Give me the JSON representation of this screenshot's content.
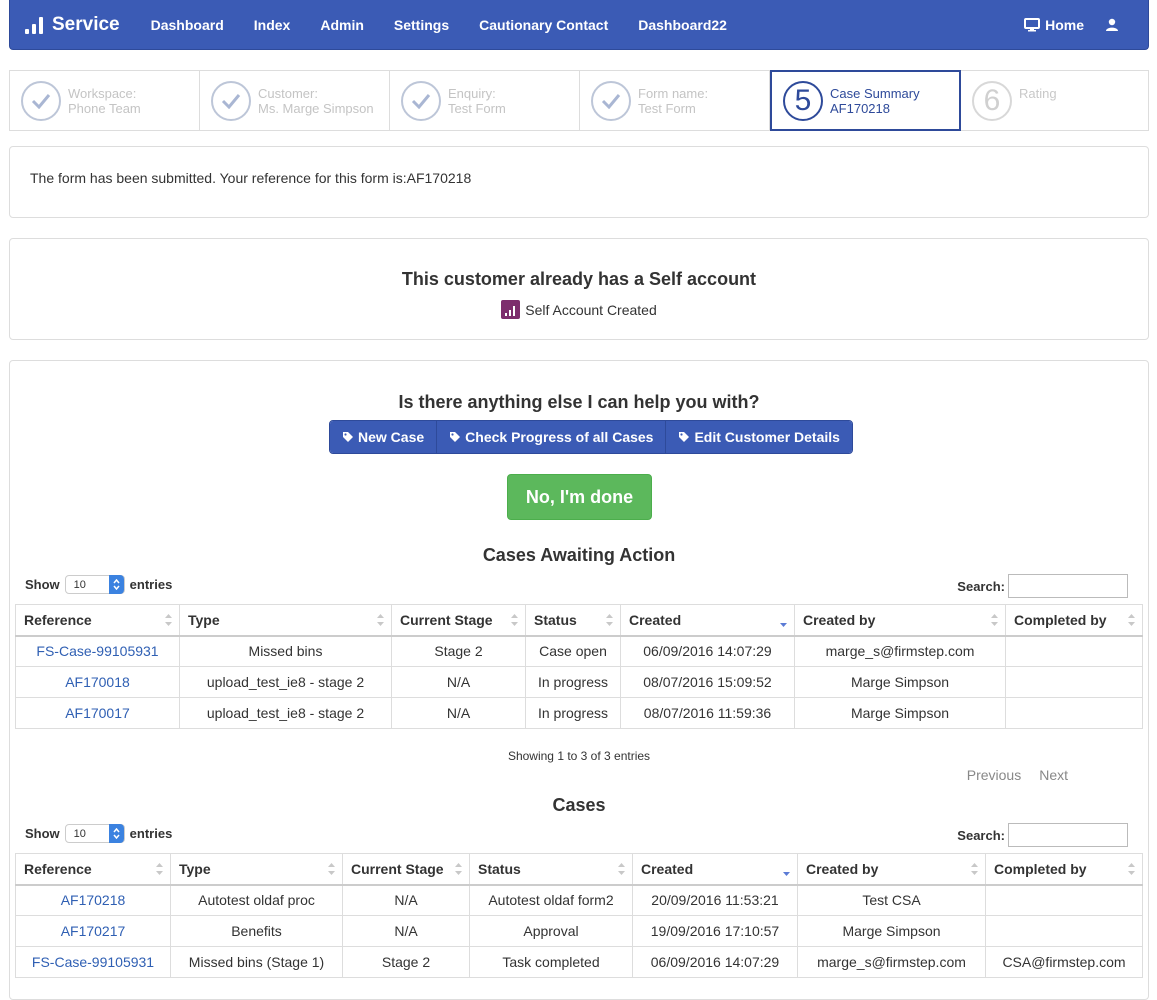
{
  "nav": {
    "brand": "Service",
    "items": [
      "Dashboard",
      "Index",
      "Admin",
      "Settings",
      "Cautionary Contact",
      "Dashboard22"
    ],
    "home": "Home"
  },
  "stepper": [
    {
      "label": "Workspace:",
      "value": "Phone Team",
      "state": "done"
    },
    {
      "label": "Customer:",
      "value": "Ms. Marge Simpson",
      "state": "done"
    },
    {
      "label": "Enquiry:",
      "value": "Test Form",
      "state": "done"
    },
    {
      "label": "Form name:",
      "value": "Test Form",
      "state": "done"
    },
    {
      "label": "Case Summary",
      "value": "AF170218",
      "state": "active",
      "number": "5"
    },
    {
      "label": "Rating",
      "value": "",
      "state": "pending",
      "number": "6"
    }
  ],
  "submitted_message": "The form has been submitted. Your reference for this form is:AF170218",
  "self_account": {
    "heading": "This customer already has a Self account",
    "badge": "Self Account Created"
  },
  "help": {
    "question": "Is there anything else I can help you with?",
    "buttons": [
      "New Case",
      "Check Progress of all Cases",
      "Edit Customer Details"
    ],
    "done": "No, I'm done"
  },
  "awaiting": {
    "title": "Cases Awaiting Action",
    "show_label": "Show",
    "entries_label": "entries",
    "page_size": "10",
    "search_label": "Search:",
    "columns": [
      "Reference",
      "Type",
      "Current Stage",
      "Status",
      "Created",
      "Created by",
      "Completed by"
    ],
    "rows": [
      [
        "FS-Case-99105931",
        "Missed bins",
        "Stage 2",
        "Case open",
        "06/09/2016 14:07:29",
        "marge_s@firmstep.com",
        ""
      ],
      [
        "AF170018",
        "upload_test_ie8 - stage 2",
        "N/A",
        "In progress",
        "08/07/2016 15:09:52",
        "Marge Simpson",
        ""
      ],
      [
        "AF170017",
        "upload_test_ie8 - stage 2",
        "N/A",
        "In progress",
        "08/07/2016 11:59:36",
        "Marge Simpson",
        ""
      ]
    ],
    "showing": "Showing 1 to 3 of 3 entries",
    "previous": "Previous",
    "next": "Next"
  },
  "cases": {
    "title": "Cases",
    "show_label": "Show",
    "entries_label": "entries",
    "page_size": "10",
    "search_label": "Search:",
    "columns": [
      "Reference",
      "Type",
      "Current Stage",
      "Status",
      "Created",
      "Created by",
      "Completed by"
    ],
    "rows": [
      [
        "AF170218",
        "Autotest oldaf proc",
        "N/A",
        "Autotest oldaf form2",
        "20/09/2016 11:53:21",
        "Test CSA",
        ""
      ],
      [
        "AF170217",
        "Benefits",
        "N/A",
        "Approval",
        "19/09/2016 17:10:57",
        "Marge Simpson",
        ""
      ],
      [
        "FS-Case-99105931",
        "Missed bins (Stage 1)",
        "Stage 2",
        "Task completed",
        "06/09/2016 14:07:29",
        "marge_s@firmstep.com",
        "CSA@firmstep.com"
      ]
    ]
  },
  "colors": {
    "primary": "#3b5bb5",
    "success": "#5cb85c",
    "link": "#2f5fb3",
    "self_icon": "#7d2d6d"
  }
}
